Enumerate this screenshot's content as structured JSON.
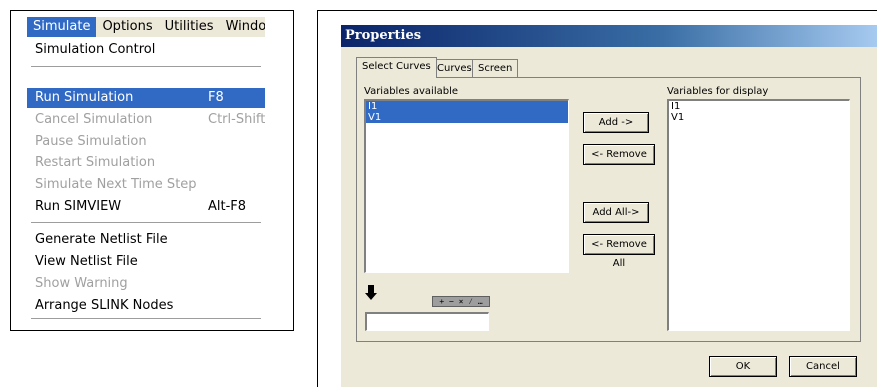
{
  "menu": {
    "menubar": [
      {
        "label": "Simulate",
        "active": true
      },
      {
        "label": "Options",
        "active": false
      },
      {
        "label": "Utilities",
        "active": false
      },
      {
        "label": "Windov",
        "active": false
      }
    ],
    "items": [
      {
        "label": "Simulation Control",
        "shortcut": "",
        "disabled": false,
        "highlight": false
      },
      {
        "label": "Run Simulation",
        "shortcut": "F8",
        "disabled": false,
        "highlight": true
      },
      {
        "label": "Cancel Simulation",
        "shortcut": "Ctrl-Shift",
        "disabled": true,
        "highlight": false
      },
      {
        "label": "Pause Simulation",
        "shortcut": "",
        "disabled": true,
        "highlight": false
      },
      {
        "label": "Restart Simulation",
        "shortcut": "",
        "disabled": true,
        "highlight": false
      },
      {
        "label": "Simulate Next Time Step",
        "shortcut": "",
        "disabled": true,
        "highlight": false
      },
      {
        "label": "Run SIMVIEW",
        "shortcut": "Alt-F8",
        "disabled": false,
        "highlight": false
      },
      {
        "label": "Generate Netlist File",
        "shortcut": "",
        "disabled": false,
        "highlight": false
      },
      {
        "label": "View Netlist File",
        "shortcut": "",
        "disabled": false,
        "highlight": false
      },
      {
        "label": "Show Warning",
        "shortcut": "",
        "disabled": true,
        "highlight": false
      },
      {
        "label": "Arrange SLINK Nodes",
        "shortcut": "",
        "disabled": false,
        "highlight": false
      }
    ]
  },
  "dialog": {
    "title": "Properties",
    "tabs": [
      {
        "label": "Select Curves",
        "active": true
      },
      {
        "label": "Curves",
        "active": false
      },
      {
        "label": "Screen",
        "active": false
      }
    ],
    "available_label": "Variables available",
    "available": [
      {
        "name": "I1",
        "selected": true
      },
      {
        "name": "V1",
        "selected": true
      }
    ],
    "display_label": "Variables for display",
    "display": [
      {
        "name": "I1"
      },
      {
        "name": "V1"
      }
    ],
    "buttons": {
      "add": "Add ->",
      "remove": "<- Remove",
      "add_all": "Add All->",
      "remove_all": "<- Remove All",
      "ok": "OK",
      "cancel": "Cancel"
    },
    "operators": "+ − × ⁄ …",
    "expression_value": ""
  },
  "colors": {
    "highlight": "#316ac5",
    "face": "#ece9d8",
    "title_start": "#0a246a",
    "title_end": "#a6caf0",
    "disabled_text": "#a0a0a0"
  }
}
